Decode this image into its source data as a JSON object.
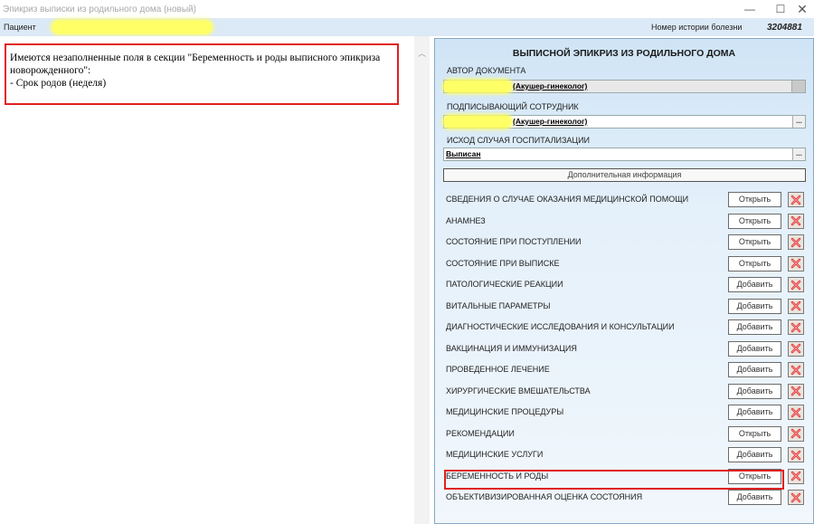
{
  "window": {
    "title": "Эпикриз выписки из родильного дома (новый)",
    "minimize": "—",
    "maximize": "☐",
    "close": "✕"
  },
  "header": {
    "patient_label": "Пациент",
    "history_label": "Номер истории болезни",
    "history_number": "3204881"
  },
  "validation": {
    "line1": "Имеются незаполненные поля в секции \"Беременность и роды выписного эпикриза новорожденного\":",
    "line2": "- Срок родов (неделя)"
  },
  "form": {
    "title": "ВЫПИСНОЙ ЭПИКРИЗ ИЗ РОДИЛЬНОГО ДОМА",
    "author_label": "АВТОР ДОКУМЕНТА",
    "author_role": "(Акушер-гинеколог)",
    "signer_label": "ПОДПИСЫВАЮЩИЙ СОТРУДНИК",
    "signer_role": "(Акушер-гинеколог)",
    "outcome_label": "ИСХОД СЛУЧАЯ ГОСПИТАЛИЗАЦИИ",
    "outcome_value": "Выписан",
    "ellipsis": "...",
    "additional_info": "Дополнительная информация"
  },
  "sections": [
    {
      "name": "СВЕДЕНИЯ О СЛУЧАЕ ОКАЗАНИЯ МЕДИЦИНСКОЙ ПОМОЩИ",
      "action": "Открыть"
    },
    {
      "name": "АНАМНЕЗ",
      "action": "Открыть"
    },
    {
      "name": "СОСТОЯНИЕ ПРИ ПОСТУПЛЕНИИ",
      "action": "Открыть"
    },
    {
      "name": "СОСТОЯНИЕ ПРИ ВЫПИСКЕ",
      "action": "Открыть"
    },
    {
      "name": "ПАТОЛОГИЧЕСКИЕ РЕАКЦИИ",
      "action": "Добавить"
    },
    {
      "name": "ВИТАЛЬНЫЕ ПАРАМЕТРЫ",
      "action": "Добавить"
    },
    {
      "name": "ДИАГНОСТИЧЕСКИЕ ИССЛЕДОВАНИЯ И КОНСУЛЬТАЦИИ",
      "action": "Добавить"
    },
    {
      "name": "ВАКЦИНАЦИЯ И ИММУНИЗАЦИЯ",
      "action": "Добавить"
    },
    {
      "name": "ПРОВЕДЕННОЕ ЛЕЧЕНИЕ",
      "action": "Добавить"
    },
    {
      "name": "ХИРУРГИЧЕСКИЕ ВМЕШАТЕЛЬСТВА",
      "action": "Добавить"
    },
    {
      "name": "МЕДИЦИНСКИЕ ПРОЦЕДУРЫ",
      "action": "Добавить"
    },
    {
      "name": "РЕКОМЕНДАЦИИ",
      "action": "Открыть"
    },
    {
      "name": "МЕДИЦИНСКИЕ УСЛУГИ",
      "action": "Добавить"
    },
    {
      "name": "БЕРЕМЕННОСТЬ И РОДЫ",
      "action": "Открыть"
    },
    {
      "name": "ОБЪЕКТИВИЗИРОВАННАЯ ОЦЕНКА СОСТОЯНИЯ",
      "action": "Добавить"
    }
  ],
  "colors": {
    "highlight_border": "#e02020",
    "redaction": "#ffff66"
  }
}
